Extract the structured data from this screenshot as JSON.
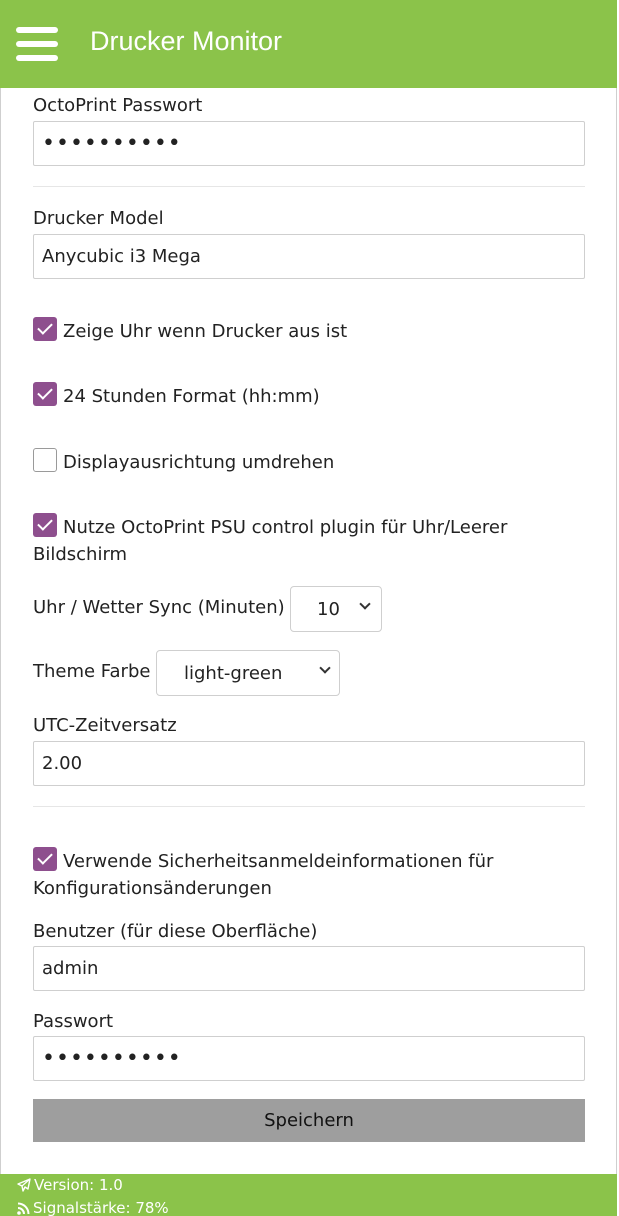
{
  "header": {
    "title": "Drucker Monitor",
    "menu_icon": "hamburger-menu-icon",
    "color": "#8bc34a"
  },
  "octoprint_password": {
    "label": "OctoPrint Passwort",
    "value": "••••••••••"
  },
  "printer_model": {
    "label": "Drucker Model",
    "value": "Anycubic i3 Mega"
  },
  "options": {
    "show_clock": {
      "label": "Zeige Uhr wenn Drucker aus ist",
      "checked": true
    },
    "format_24h": {
      "label": "24 Stunden Format (hh:mm)",
      "checked": true
    },
    "flip_display": {
      "label": "Displayausrichtung umdrehen",
      "checked": false
    },
    "psu_plugin": {
      "label": "Nutze OctoPrint PSU control plugin für Uhr/Leerer Bildschirm",
      "checked": true
    }
  },
  "sync": {
    "label": "Uhr / Wetter Sync (Minuten)",
    "value": "10"
  },
  "theme": {
    "label": "Theme Farbe",
    "value": "light-green"
  },
  "utc": {
    "label": "UTC-Zeitversatz",
    "value": "2.00"
  },
  "security": {
    "label": "Verwende Sicherheitsanmeldeinformationen für Konfigurationsänderungen",
    "checked": true
  },
  "user": {
    "label": "Benutzer (für diese Oberfläche)",
    "value": "admin"
  },
  "password": {
    "label": "Passwort",
    "value": "••••••••••"
  },
  "save_label": "Speichern",
  "footer": {
    "version": "Version: 1.0",
    "signal": "Signalstärke: 78%",
    "version_icon": "paper-plane-icon",
    "signal_icon": "rss-signal-icon"
  },
  "colors": {
    "accent": "#8bc34a",
    "checkbox": "#8e4f8e",
    "button": "#9e9e9e"
  }
}
